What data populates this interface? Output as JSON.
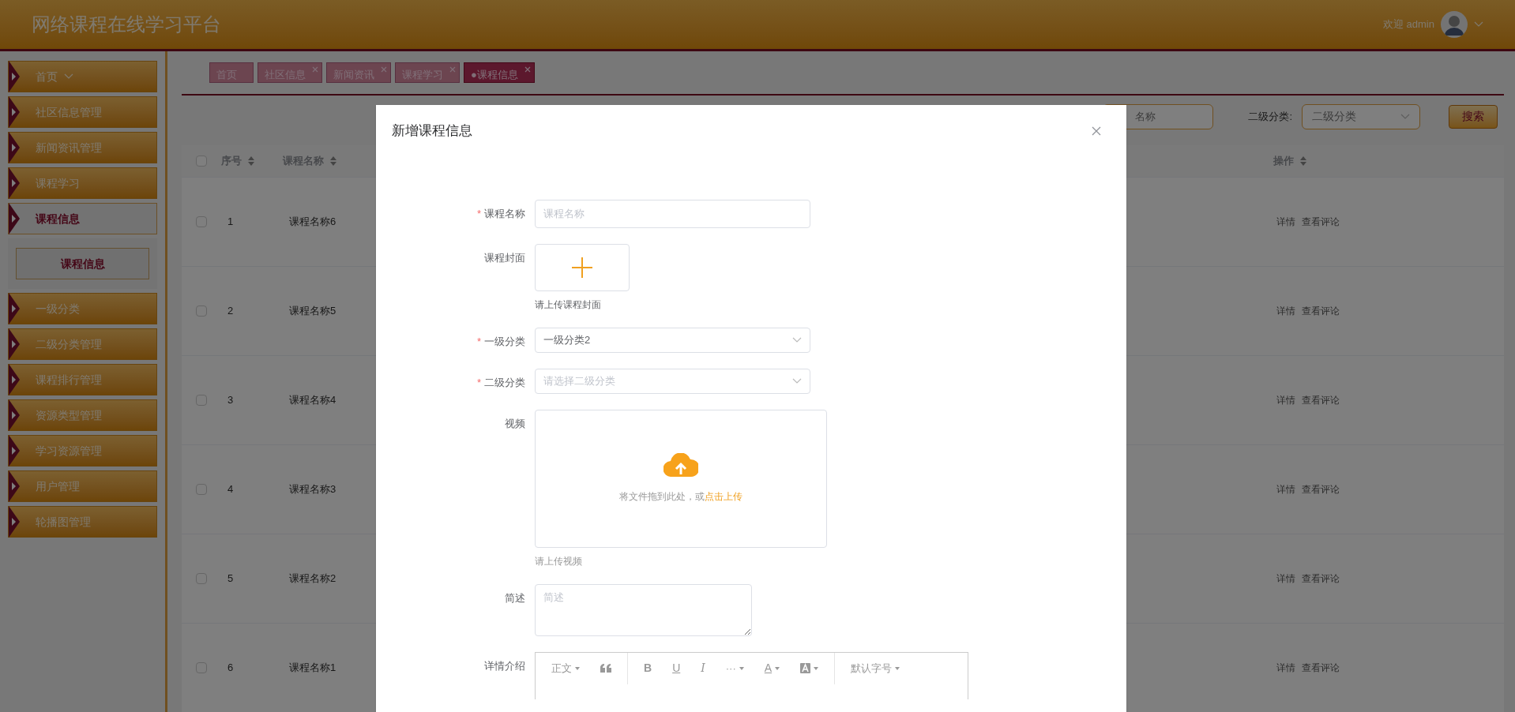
{
  "header": {
    "title": "网络课程在线学习平台",
    "greeting": "欢迎 admin"
  },
  "sidebar": {
    "items": [
      {
        "label": "首页",
        "kind": "dropdown",
        "selected": false
      },
      {
        "label": "社区信息管理",
        "kind": "plain",
        "selected": false
      },
      {
        "label": "新闻资讯管理",
        "kind": "plain",
        "selected": false
      },
      {
        "label": "课程学习",
        "kind": "plain",
        "selected": false
      },
      {
        "label": "课程信息",
        "kind": "plain",
        "selected": true,
        "children": [
          {
            "label": "课程信息",
            "selected": true
          }
        ]
      },
      {
        "label": "一级分类",
        "kind": "plain",
        "selected": false
      },
      {
        "label": "二级分类管理",
        "kind": "plain",
        "selected": false
      },
      {
        "label": "课程排行管理",
        "kind": "plain",
        "selected": false
      },
      {
        "label": "资源类型管理",
        "kind": "plain",
        "selected": false
      },
      {
        "label": "学习资源管理",
        "kind": "plain",
        "selected": false
      },
      {
        "label": "用户管理",
        "kind": "plain",
        "selected": false
      },
      {
        "label": "轮播图管理",
        "kind": "plain",
        "selected": false
      }
    ]
  },
  "tabs": [
    {
      "label": "首页",
      "selected": false,
      "closable": false
    },
    {
      "label": "社区信息",
      "selected": false,
      "closable": true
    },
    {
      "label": "新闻资讯",
      "selected": false,
      "closable": true
    },
    {
      "label": "课程学习",
      "selected": false,
      "closable": true
    },
    {
      "label": "●课程信息",
      "selected": true,
      "closable": true
    }
  ],
  "search": {
    "name_placeholder": "名称",
    "category_label": "二级分类:",
    "category_placeholder": "二级分类",
    "button": "搜索"
  },
  "table": {
    "all_checked": false,
    "columns": [
      {
        "label": "序号",
        "sortable": true
      },
      {
        "label": "课程名称",
        "sortable": true
      },
      {
        "label": "操作",
        "sortable": true
      }
    ],
    "rows": [
      {
        "index": "1",
        "name": "课程名称6",
        "checked": false,
        "actions": [
          "详情",
          "查看评论"
        ]
      },
      {
        "index": "2",
        "name": "课程名称5",
        "checked": false,
        "actions": [
          "详情",
          "查看评论"
        ]
      },
      {
        "index": "3",
        "name": "课程名称4",
        "checked": false,
        "actions": [
          "详情",
          "查看评论"
        ]
      },
      {
        "index": "4",
        "name": "课程名称3",
        "checked": false,
        "actions": [
          "详情",
          "查看评论"
        ]
      },
      {
        "index": "5",
        "name": "课程名称2",
        "checked": false,
        "actions": [
          "详情",
          "查看评论"
        ]
      },
      {
        "index": "6",
        "name": "课程名称1",
        "checked": false,
        "actions": [
          "详情",
          "查看评论"
        ]
      }
    ]
  },
  "dialog": {
    "title": "新增课程信息",
    "fields": [
      {
        "kind": "text",
        "label": "课程名称",
        "required_mark": "*",
        "placeholder": "课程名称"
      },
      {
        "kind": "image_upload",
        "label": "课程封面",
        "hint": "请上传课程封面"
      },
      {
        "kind": "select",
        "label": "一级分类",
        "required_mark": "*",
        "value": "一级分类2"
      },
      {
        "kind": "select",
        "label": "二级分类",
        "required_mark": "*",
        "placeholder": "请选择二级分类"
      },
      {
        "kind": "file_upload",
        "label": "视频",
        "drop_text": "将文件拖到此处，或",
        "link": "点击上传",
        "hint": "请上传视频"
      },
      {
        "kind": "textarea",
        "label": "简述",
        "placeholder": "简述"
      },
      {
        "kind": "editor",
        "label": "详情介绍",
        "toolbar": [
          [
            {
              "kind": "dropdown",
              "label": "正文"
            },
            {
              "kind": "quote"
            }
          ],
          [
            {
              "kind": "bold",
              "label": "B"
            },
            {
              "kind": "underline",
              "label": "U"
            },
            {
              "kind": "italic",
              "label": "I"
            },
            {
              "kind": "dropdown",
              "label": "···"
            },
            {
              "kind": "color",
              "label": "A"
            },
            {
              "kind": "highlight"
            }
          ],
          [
            {
              "kind": "dropdown",
              "label": "默认字号"
            }
          ]
        ]
      }
    ]
  }
}
